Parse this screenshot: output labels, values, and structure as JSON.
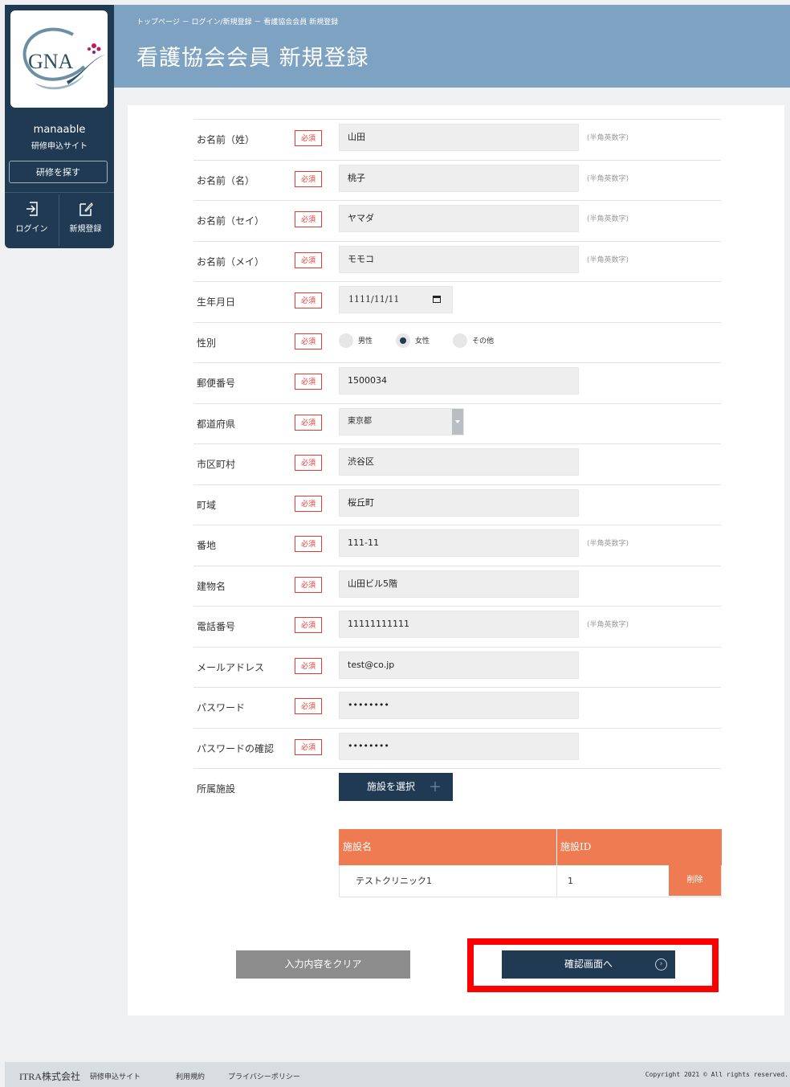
{
  "sidebar": {
    "logo_text": "GNA",
    "brand_name": "manaable",
    "brand_sub": "研修申込サイト",
    "search_button": "研修を探す",
    "login_label": "ログイン",
    "register_label": "新規登録"
  },
  "header": {
    "breadcrumb": "トップページ － ログイン/新規登録 － 看護協会会員 新規登録",
    "title": "看護協会会員 新規登録"
  },
  "required_label": "必須",
  "hint_label": "(半角英数字)",
  "form": {
    "last_name": {
      "label": "お名前（姓）",
      "value": "山田"
    },
    "first_name": {
      "label": "お名前（名）",
      "value": "桃子"
    },
    "last_name_kana": {
      "label": "お名前（セイ）",
      "value": "ヤマダ"
    },
    "first_name_kana": {
      "label": "お名前（メイ）",
      "value": "モモコ"
    },
    "birthdate": {
      "label": "生年月日",
      "value": "1111/11/11"
    },
    "gender": {
      "label": "性別",
      "options": [
        "男性",
        "女性",
        "その他"
      ],
      "selected": "女性"
    },
    "postal_code": {
      "label": "郵便番号",
      "value": "1500034"
    },
    "prefecture": {
      "label": "都道府県",
      "value": "東京都"
    },
    "city": {
      "label": "市区町村",
      "value": "渋谷区"
    },
    "town": {
      "label": "町域",
      "value": "桜丘町"
    },
    "address_number": {
      "label": "番地",
      "value": "111-11"
    },
    "building": {
      "label": "建物名",
      "value": "山田ビル5階"
    },
    "phone": {
      "label": "電話番号",
      "value": "11111111111"
    },
    "email": {
      "label": "メールアドレス",
      "value": "test@co.jp"
    },
    "password": {
      "label": "パスワード",
      "value": "••••••••"
    },
    "password_confirm": {
      "label": "パスワードの確認",
      "value": "••••••••"
    },
    "facility": {
      "label": "所属施設",
      "button": "施設を選択"
    }
  },
  "facility_table": {
    "headers": [
      "施設名",
      "施設ID"
    ],
    "rows": [
      {
        "name": "テストクリニック1",
        "id": "1",
        "action": "削除"
      }
    ]
  },
  "buttons": {
    "clear": "入力内容をクリア",
    "confirm": "確認画面へ"
  },
  "footer": {
    "company": "ITRA株式会社",
    "site": "研修申込サイト",
    "terms": "利用規約",
    "privacy": "プライバシーポリシー",
    "copyright": "Copyright 2021 © All rights reserved."
  },
  "colors": {
    "navy": "#1f3a52",
    "header_blue": "#7ea2c1",
    "required_red": "#e53935",
    "table_orange": "#ee7b52",
    "highlight_red": "#ff0000"
  }
}
